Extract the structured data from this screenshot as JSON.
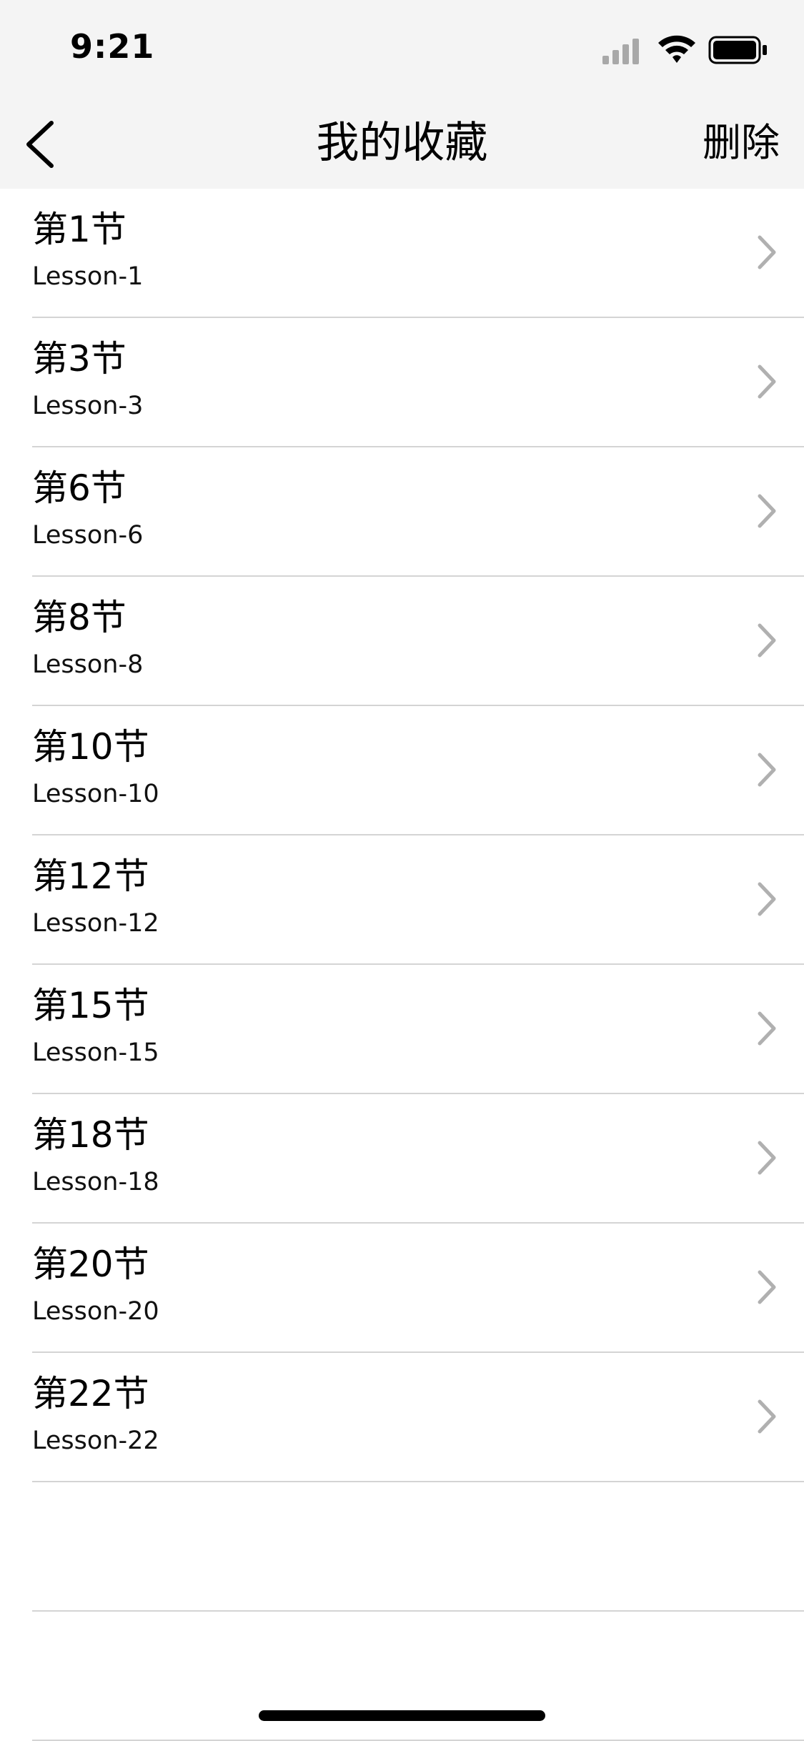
{
  "status_bar": {
    "time": "9:21"
  },
  "nav": {
    "title": "我的收藏",
    "delete_label": "删除"
  },
  "items": [
    {
      "title": "第1节",
      "subtitle": "Lesson-1"
    },
    {
      "title": "第3节",
      "subtitle": "Lesson-3"
    },
    {
      "title": "第6节",
      "subtitle": "Lesson-6"
    },
    {
      "title": "第8节",
      "subtitle": "Lesson-8"
    },
    {
      "title": "第10节",
      "subtitle": "Lesson-10"
    },
    {
      "title": "第12节",
      "subtitle": "Lesson-12"
    },
    {
      "title": "第15节",
      "subtitle": "Lesson-15"
    },
    {
      "title": "第18节",
      "subtitle": "Lesson-18"
    },
    {
      "title": "第20节",
      "subtitle": "Lesson-20"
    },
    {
      "title": "第22节",
      "subtitle": "Lesson-22"
    }
  ],
  "colors": {
    "header_bg": "#f4f4f4",
    "separator": "#d4d4d4",
    "chevron": "#b0b0b0"
  },
  "icons": [
    "signal-icon",
    "wifi-icon",
    "battery-icon",
    "back-chevron-icon",
    "chevron-right-icon"
  ]
}
